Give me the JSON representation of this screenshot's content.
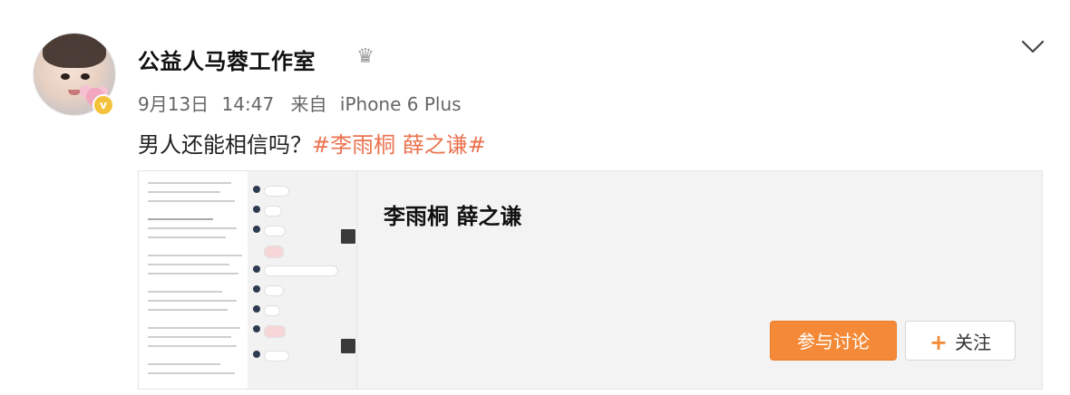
{
  "post": {
    "author": "公益人马蓉工作室",
    "date": "9月13日",
    "time": "14:47",
    "source_prefix": "来自",
    "device": "iPhone 6 Plus",
    "text_main": "男人还能相信吗？",
    "topic": "#李雨桐 薛之谦#"
  },
  "card": {
    "title": "李雨桐 薛之谦",
    "join_button": "参与讨论",
    "follow_button": "关注",
    "follow_plus": "+"
  },
  "badge": {
    "verified_letter": "v"
  },
  "icons": {
    "crown": "crown-icon",
    "chevron": "chevron-down-icon",
    "verified": "verified-badge-icon",
    "plus": "plus-icon",
    "play": "play-icon"
  },
  "colors": {
    "accent": "#eb7350",
    "button_orange": "#f48a37",
    "badge_yellow": "#f4c23a"
  }
}
